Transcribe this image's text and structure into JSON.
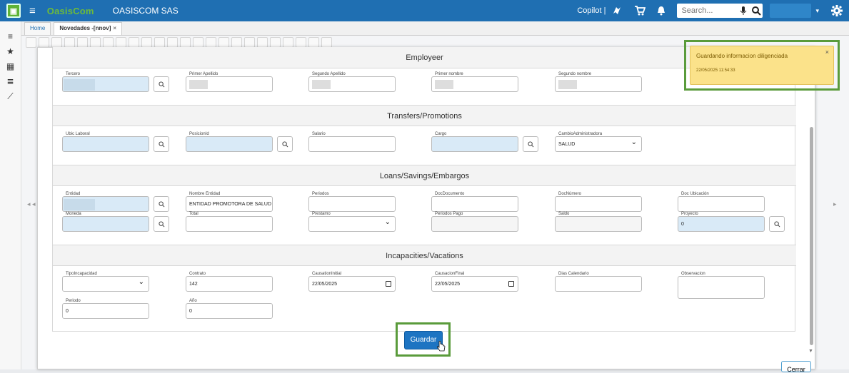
{
  "topbar": {
    "logo_glyph": "▣",
    "menu_icon": "≡",
    "brand": "OasisCom",
    "company": "OASISCOM SAS",
    "copilot_label": "Copilot |",
    "search_placeholder": "Search...",
    "user_caret": "▾"
  },
  "sidebar": {
    "icons": [
      "≡",
      "★",
      "▦",
      "≣",
      "⟋"
    ]
  },
  "tabs": [
    {
      "label": "Home"
    },
    {
      "label": "Novedades -[nnov]",
      "close": "×"
    }
  ],
  "sections": {
    "employeer": "Employeer",
    "transfers": "Transfers/Promotions",
    "loans": "Loans/Savings/Embargos",
    "incapacities": "Incapacities/Vacations"
  },
  "fields": {
    "tercero": {
      "label": "Tercero",
      "value": ""
    },
    "primer_apellido": {
      "label": "Primer Apellido",
      "value": ""
    },
    "segundo_apellido": {
      "label": "Segundo Apellido",
      "value": ""
    },
    "primer_nombre": {
      "label": "Primer nombre",
      "value": ""
    },
    "segundo_nombre": {
      "label": "Segundo nombre",
      "value": ""
    },
    "ubic_laboral": {
      "label": "Ubic Laboral",
      "value": ""
    },
    "posicion_id": {
      "label": "PosicionId",
      "value": ""
    },
    "salario": {
      "label": "Salario",
      "value": ""
    },
    "cargo": {
      "label": "Cargo",
      "value": ""
    },
    "cambio_admin": {
      "label": "CambioAdministradora",
      "value": "SALUD"
    },
    "entidad": {
      "label": "Entidad",
      "value": ""
    },
    "nombre_entidad": {
      "label": "Nombre Entidad",
      "value": "ENTIDAD PROMOTORA DE SALUD SANITAS S"
    },
    "periodos": {
      "label": "Periodos",
      "value": ""
    },
    "doc_documento": {
      "label": "DocDocumento",
      "value": ""
    },
    "doc_numero": {
      "label": "DocNúmero",
      "value": ""
    },
    "doc_ubicacion": {
      "label": "Doc Ubicación",
      "value": ""
    },
    "moneda": {
      "label": "Moneda",
      "value": ""
    },
    "total": {
      "label": "Total",
      "value": ""
    },
    "prestamo": {
      "label": "Prestamo",
      "value": ""
    },
    "periodos_pago": {
      "label": "Periodos Pago",
      "value": ""
    },
    "saldo": {
      "label": "Saldo",
      "value": ""
    },
    "proyecto": {
      "label": "Proyecto",
      "value": "0"
    },
    "tipo_incapacidad": {
      "label": "TipoIncapacidad",
      "value": ""
    },
    "contrato": {
      "label": "Contrato",
      "value": "142"
    },
    "causation_initial": {
      "label": "CausationInitial",
      "value": "22/05/2025"
    },
    "causacion_final": {
      "label": "CausacionFinal",
      "value": "22/05/2025"
    },
    "dias_calendario": {
      "label": "Dias Calendario",
      "value": ""
    },
    "observacion": {
      "label": "Observacion",
      "value": ""
    },
    "periodo": {
      "label": "Periodo",
      "value": "0"
    },
    "anio": {
      "label": "Año",
      "value": "0"
    }
  },
  "buttons": {
    "guardar": "Guardar",
    "cerrar": "Cerrar"
  },
  "toast": {
    "message": "Guardando informacion diligenciada",
    "time": "22/05/2025 11:54:33",
    "close": "×"
  },
  "colors": {
    "topbar": "#1f6fb2",
    "primary_button": "#1d74c2",
    "highlight": "#5a9b3b",
    "toast_bg": "#fbe28a"
  }
}
